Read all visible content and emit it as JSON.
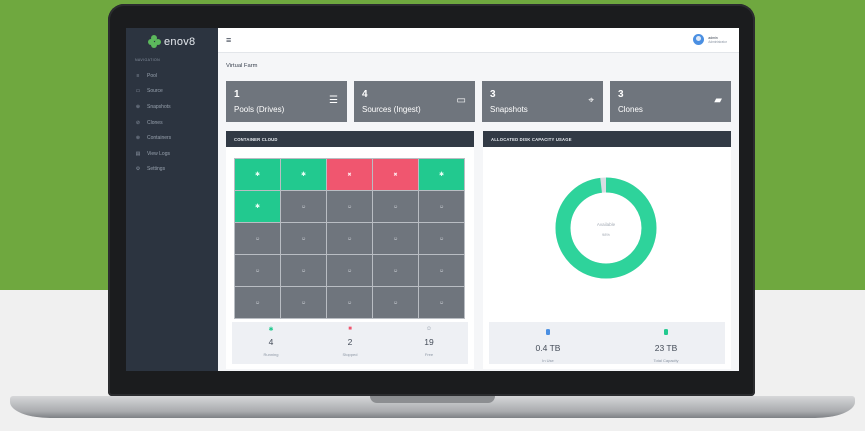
{
  "sidebar": {
    "logo": "enov8",
    "heading": "NAVIGATION",
    "items": [
      {
        "label": "Pool",
        "icon": "pool-icon",
        "glyph": "≡"
      },
      {
        "label": "Source",
        "icon": "folder-icon",
        "glyph": "▭"
      },
      {
        "label": "Snapshots",
        "icon": "target-icon",
        "glyph": "⊕"
      },
      {
        "label": "Clones",
        "icon": "clone-icon",
        "glyph": "⊘"
      },
      {
        "label": "Containers",
        "icon": "container-icon",
        "glyph": "⊛"
      },
      {
        "label": "View Logs",
        "icon": "log-icon",
        "glyph": "▤"
      },
      {
        "label": "Settings",
        "icon": "gear-icon",
        "glyph": "⚙"
      }
    ]
  },
  "topbar": {
    "menu_glyph": "≡",
    "user_name": "admin",
    "user_role": "Administrator"
  },
  "page": {
    "title": "Virtual Farm"
  },
  "cards": [
    {
      "number": "1",
      "label": "Pools (Drives)",
      "icon": "pools-icon",
      "glyph": "☰"
    },
    {
      "number": "4",
      "label": "Sources (Ingest)",
      "icon": "folder-icon",
      "glyph": "▭"
    },
    {
      "number": "3",
      "label": "Snapshots",
      "icon": "crosshair-icon",
      "glyph": "⌖"
    },
    {
      "number": "3",
      "label": "Clones",
      "icon": "folders-icon",
      "glyph": "▰"
    }
  ],
  "container_cloud": {
    "title": "CONTAINER CLOUD",
    "cells": [
      "running",
      "running",
      "stopped",
      "stopped",
      "running",
      "running",
      "free",
      "free",
      "free",
      "free",
      "free",
      "free",
      "free",
      "free",
      "free",
      "free",
      "free",
      "free",
      "free",
      "free",
      "free",
      "free",
      "free",
      "free",
      "free"
    ],
    "glyphs": {
      "running": "✱",
      "stopped": "✖",
      "free": "☺"
    },
    "stats": [
      {
        "icon": "running-icon",
        "glyph": "✱",
        "color": "#22c98f",
        "value": "4",
        "label": "Running"
      },
      {
        "icon": "stopped-icon",
        "glyph": "■",
        "color": "#f0566f",
        "value": "2",
        "label": "Stopped"
      },
      {
        "icon": "free-icon",
        "glyph": "☺",
        "color": "#8b95a3",
        "value": "19",
        "label": "Free"
      }
    ]
  },
  "disk_usage": {
    "title": "ALLOCATED DISK CAPACITY USAGE",
    "donut_label": "Available",
    "donut_percent": "98%",
    "available_fraction": 0.98,
    "colors": {
      "available": "#2ed39b",
      "used": "#d9dde3"
    },
    "stats": [
      {
        "icon": "database-icon",
        "color": "#4a8fe2",
        "value": "0.4 TB",
        "label": "In Use"
      },
      {
        "icon": "database-icon",
        "color": "#22c98f",
        "value": "23 TB",
        "label": "Total Capacity"
      }
    ]
  }
}
